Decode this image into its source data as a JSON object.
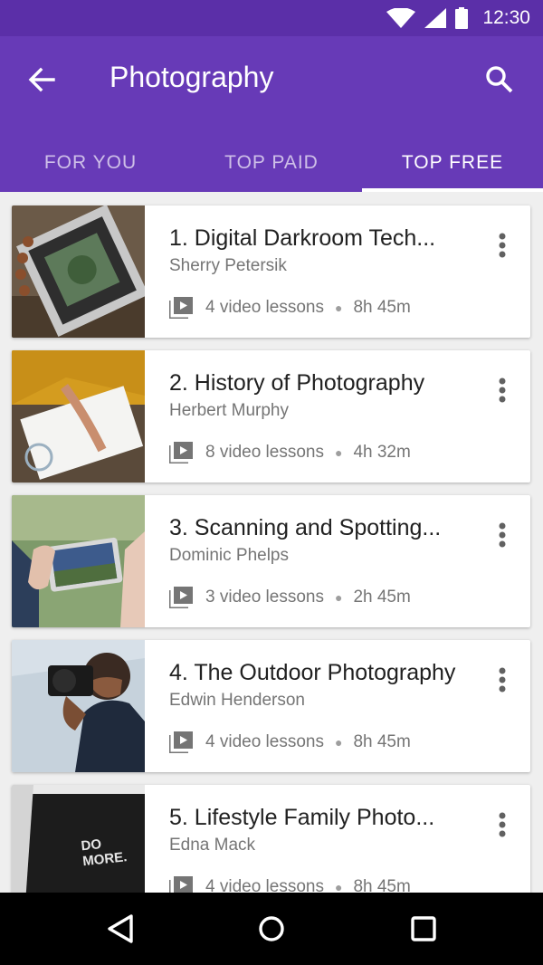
{
  "status_bar": {
    "time": "12:30"
  },
  "app_bar": {
    "title": "Photography"
  },
  "tabs": [
    {
      "label": "FOR YOU",
      "active": false
    },
    {
      "label": "TOP PAID",
      "active": false
    },
    {
      "label": "TOP FREE",
      "active": true
    }
  ],
  "courses": [
    {
      "title": "1. Digital Darkroom Tech...",
      "author": "Sherry Petersik",
      "lessons": "4 video lessons",
      "duration": "8h 45m"
    },
    {
      "title": "2. History of Photography",
      "author": "Herbert Murphy",
      "lessons": "8 video lessons",
      "duration": "4h 32m"
    },
    {
      "title": "3. Scanning and Spotting...",
      "author": "Dominic Phelps",
      "lessons": "3 video lessons",
      "duration": "2h 45m"
    },
    {
      "title": "4. The Outdoor Photography",
      "author": "Edwin Henderson",
      "lessons": "4 video lessons",
      "duration": "8h 45m"
    },
    {
      "title": "5. Lifestyle Family Photo...",
      "author": "Edna Mack",
      "lessons": "4 video lessons",
      "duration": "8h 45m",
      "thumb_text": "DO MORE."
    }
  ],
  "colors": {
    "primary": "#673ab7",
    "primary_dark": "#5b2fa8",
    "text_primary": "#212121",
    "text_secondary": "#757575"
  }
}
